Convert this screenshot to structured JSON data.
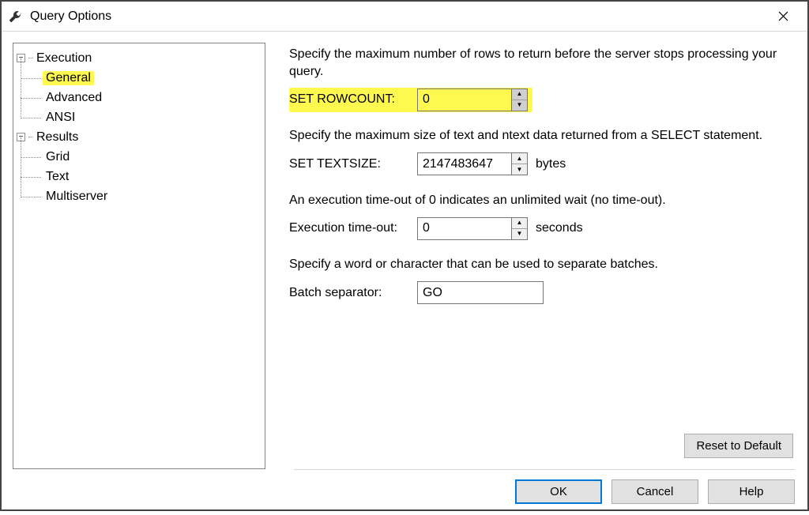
{
  "window": {
    "title": "Query Options"
  },
  "tree": {
    "execution": {
      "label": "Execution",
      "general": "General",
      "advanced": "Advanced",
      "ansi": "ANSI"
    },
    "results": {
      "label": "Results",
      "grid": "Grid",
      "text": "Text",
      "multiserver": "Multiserver"
    }
  },
  "content": {
    "rowcount_desc": "Specify the maximum number of rows to return before the server stops processing your query.",
    "rowcount_label": "SET ROWCOUNT:",
    "rowcount_value": "0",
    "textsize_desc": "Specify the maximum size of text and ntext data returned from a SELECT statement.",
    "textsize_label": "SET TEXTSIZE:",
    "textsize_value": "2147483647",
    "textsize_suffix": "bytes",
    "timeout_desc": "An execution time-out of 0 indicates an unlimited wait (no time-out).",
    "timeout_label": "Execution time-out:",
    "timeout_value": "0",
    "timeout_suffix": "seconds",
    "batch_desc": "Specify a word or character that can be used to separate batches.",
    "batch_label": "Batch separator:",
    "batch_value": "GO",
    "reset_label": "Reset to Default"
  },
  "footer": {
    "ok": "OK",
    "cancel": "Cancel",
    "help": "Help"
  }
}
